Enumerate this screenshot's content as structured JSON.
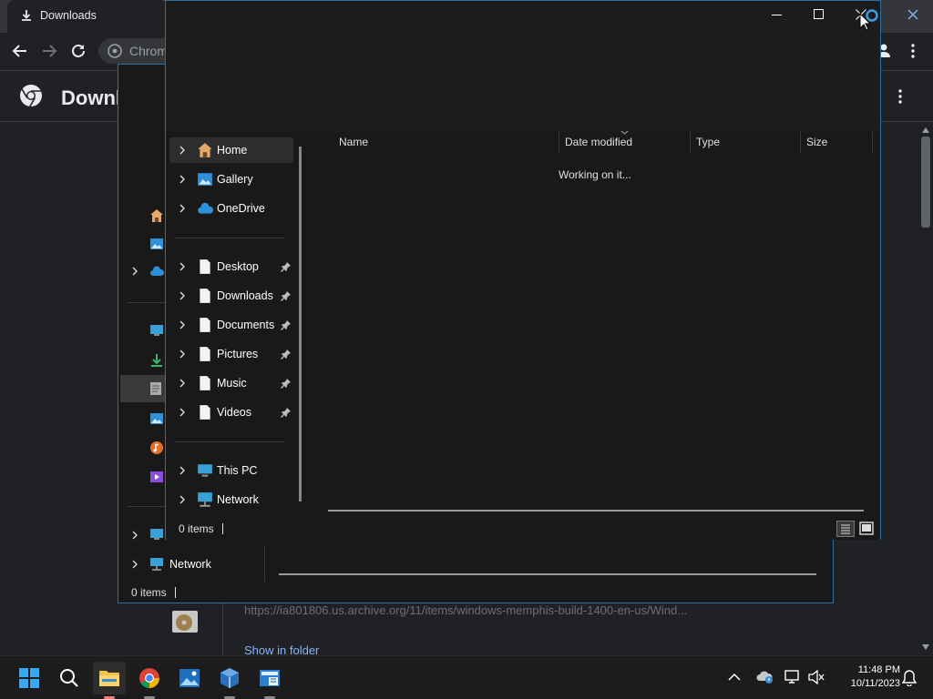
{
  "chrome": {
    "tab_title": "Downloads",
    "omnibox_text": "Chrom",
    "page_title": "Downl",
    "download_url": "https://ia801806.us.archive.org/11/items/windows-memphis-build-1400-en-us/Wind...",
    "show_in_folder": "Show in folder"
  },
  "explorer_back": {
    "nav": {
      "network_label": "Network"
    },
    "status_text": "0 items"
  },
  "explorer_front": {
    "nav_items": [
      {
        "label": "Home",
        "icon": "home-icon"
      },
      {
        "label": "Gallery",
        "icon": "gallery-icon"
      },
      {
        "label": "OneDrive",
        "icon": "cloud-icon"
      }
    ],
    "quick_access": [
      {
        "label": "Desktop",
        "icon": "document-icon"
      },
      {
        "label": "Downloads",
        "icon": "document-icon"
      },
      {
        "label": "Documents",
        "icon": "document-icon"
      },
      {
        "label": "Pictures",
        "icon": "document-icon"
      },
      {
        "label": "Music",
        "icon": "document-icon"
      },
      {
        "label": "Videos",
        "icon": "document-icon"
      }
    ],
    "bottom_nav": [
      {
        "label": "This PC",
        "icon": "computer-icon"
      },
      {
        "label": "Network",
        "icon": "network-icon"
      }
    ],
    "columns": [
      "Name",
      "Date modified",
      "Type",
      "Size"
    ],
    "working_text": "Working on it...",
    "status_text": "0 items"
  },
  "taskbar": {
    "apps": [
      "start-icon",
      "search-icon",
      "file-explorer-icon",
      "chrome-icon",
      "photos-icon",
      "virtualbox-icon",
      "app-icon"
    ],
    "time": "11:48 PM",
    "date": "10/11/2023"
  },
  "colors": {
    "window_border": "#2e6fa7",
    "link": "#8ab4f8",
    "explorer_bg": "#191919"
  }
}
